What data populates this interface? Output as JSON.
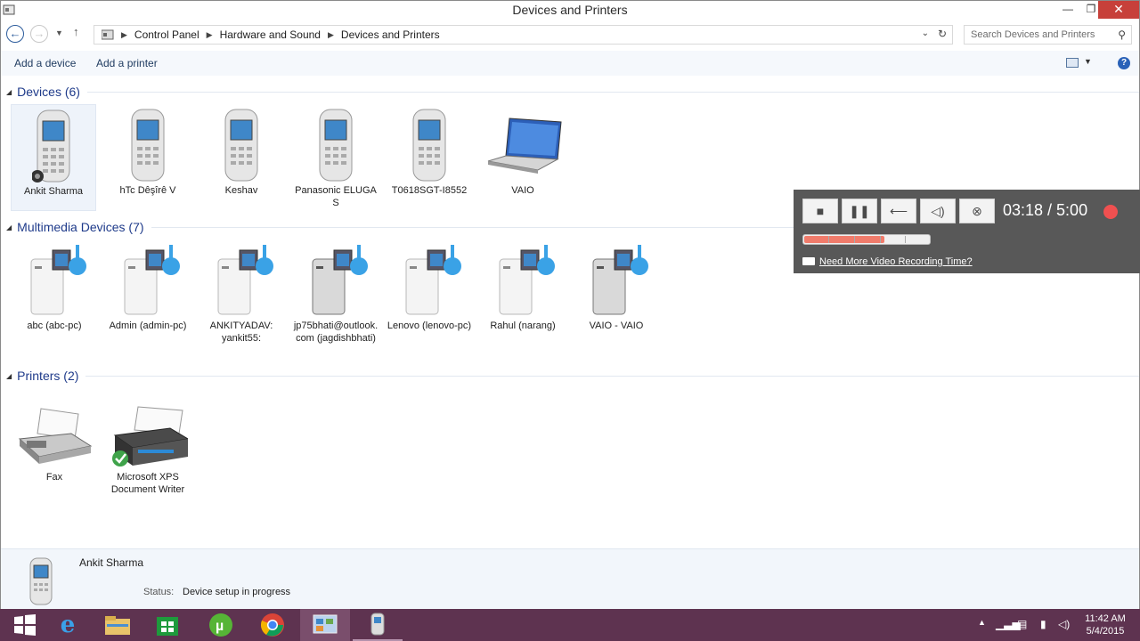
{
  "window": {
    "title": "Devices and Printers"
  },
  "nav": {
    "breadcrumbs": [
      "Control Panel",
      "Hardware and Sound",
      "Devices and Printers"
    ],
    "search_placeholder": "Search Devices and Printers"
  },
  "commands": {
    "add_device": "Add a device",
    "add_printer": "Add a printer"
  },
  "groups": {
    "devices": {
      "title": "Devices (6)",
      "items": [
        {
          "label": "Ankit Sharma"
        },
        {
          "label": "hTc Dêşîrê V"
        },
        {
          "label": "Keshav"
        },
        {
          "label": "Panasonic ELUGA S"
        },
        {
          "label": "T0618SGT-I8552"
        },
        {
          "label": "VAIO"
        }
      ]
    },
    "multimedia": {
      "title": "Multimedia Devices (7)",
      "items": [
        {
          "label": "abc (abc-pc)"
        },
        {
          "label": "Admin (admin-pc)"
        },
        {
          "label": "ANKITYADAV: yankit55:"
        },
        {
          "label": "jp75bhati@outlook.com (jagdishbhati)"
        },
        {
          "label": "Lenovo (lenovo-pc)"
        },
        {
          "label": "Rahul (narang)"
        },
        {
          "label": "VAIO - VAIO"
        }
      ]
    },
    "printers": {
      "title": "Printers (2)",
      "items": [
        {
          "label": "Fax"
        },
        {
          "label": "Microsoft XPS Document Writer"
        }
      ]
    }
  },
  "details": {
    "name": "Ankit Sharma",
    "status_label": "Status:",
    "status_value": "Device setup in progress"
  },
  "recorder": {
    "time": "03:18 / 5:00",
    "progress": 0.64,
    "link": "Need More Video Recording Time?"
  },
  "clock": {
    "time": "11:42 AM",
    "date": "5/4/2015"
  },
  "colors": {
    "taskbar": "#5e3350",
    "header_text": "#1e3a8a",
    "record": "#f05050"
  },
  "icons": [
    "back-arrow-icon",
    "forward-arrow-icon",
    "up-arrow-icon",
    "refresh-icon",
    "search-icon",
    "help-icon",
    "phone-icon",
    "laptop-icon",
    "media-server-icon",
    "fax-icon",
    "printer-icon"
  ]
}
